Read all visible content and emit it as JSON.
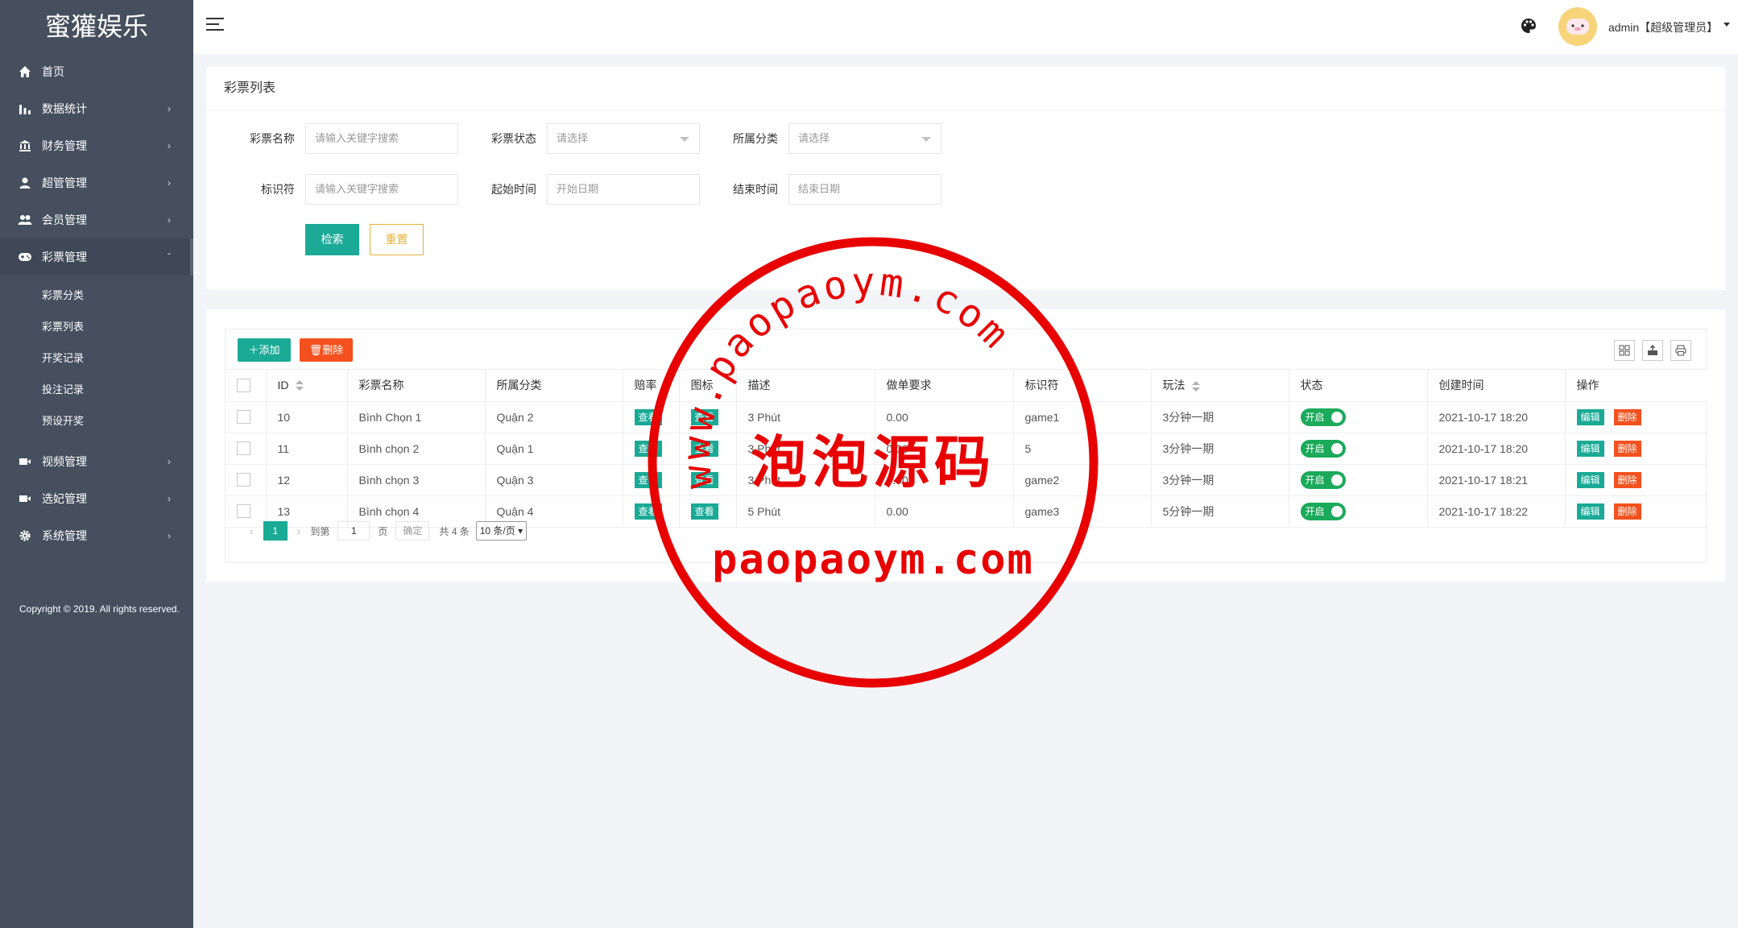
{
  "app": {
    "title": "蜜獾娱乐"
  },
  "sidebar": {
    "items": [
      {
        "label": "首页",
        "icon": "home-icon"
      },
      {
        "label": "数据统计",
        "icon": "bar-chart-icon"
      },
      {
        "label": "财务管理",
        "icon": "bank-icon"
      },
      {
        "label": "超管管理",
        "icon": "user-icon"
      },
      {
        "label": "会员管理",
        "icon": "users-icon"
      },
      {
        "label": "彩票管理",
        "icon": "gamepad-icon"
      },
      {
        "label": "视频管理",
        "icon": "video-icon"
      },
      {
        "label": "选妃管理",
        "icon": "video-icon"
      },
      {
        "label": "系统管理",
        "icon": "gear-icon"
      }
    ],
    "sub_items": [
      "彩票分类",
      "彩票列表",
      "开奖记录",
      "投注记录",
      "预设开奖"
    ],
    "copyright": "Copyright © 2019. All rights reserved."
  },
  "header": {
    "user": "admin【超级管理员】",
    "icons": {
      "menu": "hamburger-icon",
      "theme": "palette-icon",
      "avatar": "avatar"
    }
  },
  "search": {
    "title": "彩票列表",
    "fields": {
      "name_label": "彩票名称",
      "name_placeholder": "请输入关键字搜索",
      "status_label": "彩票状态",
      "status_placeholder": "请选择",
      "category_label": "所属分类",
      "category_placeholder": "请选择",
      "key_label": "标识符",
      "key_placeholder": "请输入关键字搜索",
      "start_label": "起始时间",
      "start_placeholder": "开始日期",
      "end_label": "结束时间",
      "end_placeholder": "结束日期"
    },
    "search_button": "检索",
    "reset_button": "重置"
  },
  "table": {
    "toolbar": {
      "add": "添加",
      "delete": "删除"
    },
    "headers": [
      "ID",
      "彩票名称",
      "所属分类",
      "赔率",
      "图标",
      "描述",
      "做单要求",
      "标识符",
      "玩法",
      "状态",
      "创建时间",
      "操作"
    ],
    "rows": [
      {
        "id": "10",
        "name": "Bình Chọn 1",
        "category": "Quận 2",
        "odds": "查看",
        "icon": "查看",
        "desc": "3 Phút",
        "req": "0.00",
        "key": "game1",
        "play": "3分钟一期",
        "status": "开启",
        "created": "2021-10-17 18:20",
        "edit": "编辑",
        "remove": "删除"
      },
      {
        "id": "11",
        "name": "Bình chọn 2",
        "category": "Quận 1",
        "odds": "查看",
        "icon": "查看",
        "desc": "3 Phút",
        "req": "0.00",
        "key": "5",
        "play": "3分钟一期",
        "status": "开启",
        "created": "2021-10-17 18:20",
        "edit": "编辑",
        "remove": "删除"
      },
      {
        "id": "12",
        "name": "Bình chọn 3",
        "category": "Quận 3",
        "odds": "查看",
        "icon": "查看",
        "desc": "3 Phút",
        "req": "0.00",
        "key": "game2",
        "play": "3分钟一期",
        "status": "开启",
        "created": "2021-10-17 18:21",
        "edit": "编辑",
        "remove": "删除"
      },
      {
        "id": "13",
        "name": "Bình chọn 4",
        "category": "Quận 4",
        "odds": "查看",
        "icon": "查看",
        "desc": "5 Phút",
        "req": "0.00",
        "key": "game3",
        "play": "5分钟一期",
        "status": "开启",
        "created": "2021-10-17 18:22",
        "edit": "编辑",
        "remove": "删除"
      }
    ],
    "pager": {
      "current": "1",
      "goto_label": "到第",
      "page_input": "1",
      "page_label": "页",
      "confirm": "确定",
      "total": "共 4 条",
      "page_size": "10 条/页"
    }
  },
  "watermark": {
    "arc_text": "www.paopaoym.com",
    "center_text": "泡泡源码",
    "bottom_text": "paopaoym.com",
    "color": "#e80000"
  },
  "colors": {
    "sidebar": "#454f5e",
    "primary": "#1aaa96",
    "danger": "#f4511e",
    "warning": "#e3b23c",
    "switch_on": "#1aaa5a"
  }
}
